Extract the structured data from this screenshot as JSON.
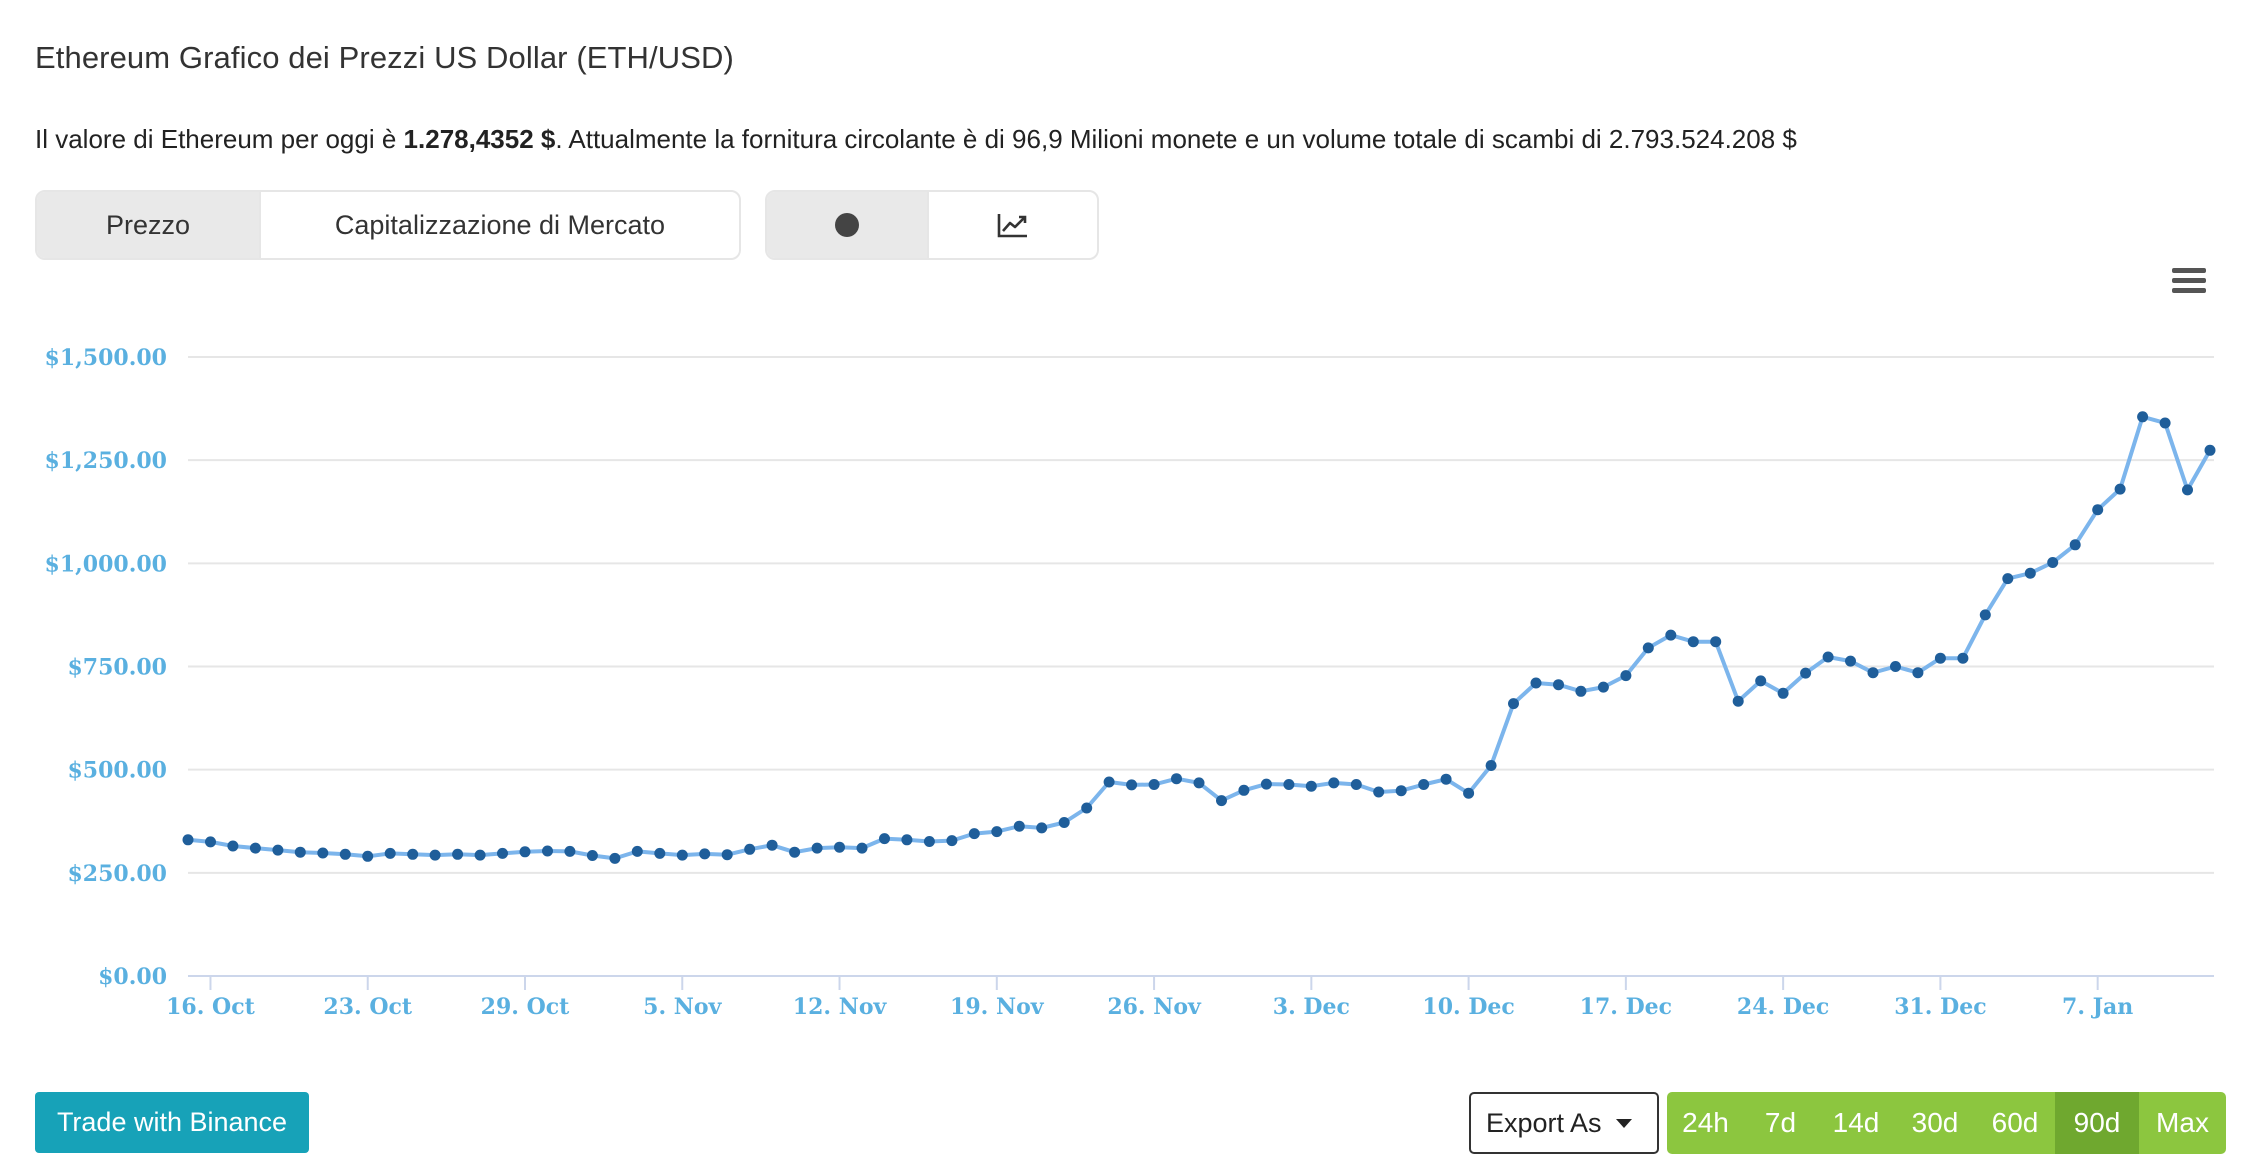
{
  "header": {
    "title": "Ethereum Grafico dei Prezzi US Dollar (ETH/USD)",
    "desc_prefix": "Il valore di Ethereum per oggi è ",
    "desc_price": "1.278,4352 $",
    "desc_suffix": ". Attualmente la fornitura circolante è di 96,9 Milioni monete e un volume totale di scambi di 2.793.524.208 $"
  },
  "tabs": {
    "price": "Prezzo",
    "market_cap": "Capitalizzazione di Mercato",
    "selected": "Prezzo"
  },
  "view_toggle": {
    "icons": [
      "dot-icon",
      "line-chart-icon"
    ],
    "selected": "dot-icon"
  },
  "footer": {
    "trade_label": "Trade with Binance",
    "export_label": "Export As",
    "ranges": [
      "24h",
      "7d",
      "14d",
      "30d",
      "60d",
      "90d",
      "Max"
    ],
    "selected_range": "90d"
  },
  "colors": {
    "line": "#7cb5ec",
    "marker": "#1f5e9a",
    "axis_label": "#5ab0e0",
    "grid": "#e6e6e6",
    "trade_button": "#17a2b8",
    "range_button": "#8cc63f",
    "range_button_active": "#6fa82f"
  },
  "chart_data": {
    "type": "line",
    "x_start": "2020-10-15",
    "x_end": "2021-01-12",
    "x_step_days": 1,
    "xticks": [
      "16. Oct",
      "23. Oct",
      "29. Oct",
      "5. Nov",
      "12. Nov",
      "19. Nov",
      "26. Nov",
      "3. Dec",
      "10. Dec",
      "17. Dec",
      "24. Dec",
      "31. Dec",
      "7. Jan"
    ],
    "yticks": [
      "$0.00",
      "$250.00",
      "$500.00",
      "$750.00",
      "$1,000.00",
      "$1,250.00",
      "$1,500.00"
    ],
    "ylim": [
      0,
      1500
    ],
    "grid": true,
    "markers": true,
    "series": [
      {
        "values": [
          330,
          325,
          315,
          310,
          305,
          300,
          298,
          295,
          290,
          297,
          295,
          293,
          295,
          293,
          297,
          301,
          303,
          302,
          292,
          285,
          302,
          297,
          293,
          296,
          294,
          307,
          317,
          300,
          310,
          312,
          310,
          333,
          330,
          326,
          328,
          345,
          350,
          363,
          359,
          372,
          407,
          470,
          463,
          464,
          478,
          468,
          425,
          450,
          465,
          464,
          460,
          468,
          464,
          446,
          449,
          464,
          477,
          443,
          510,
          660,
          710,
          706,
          690,
          700,
          728,
          795,
          826,
          810,
          810,
          666,
          715,
          685,
          734,
          773,
          763,
          735,
          750,
          735,
          770,
          770,
          875,
          963,
          976,
          1002,
          1045,
          1130,
          1180,
          1355,
          1340,
          1178,
          1274
        ]
      }
    ]
  }
}
